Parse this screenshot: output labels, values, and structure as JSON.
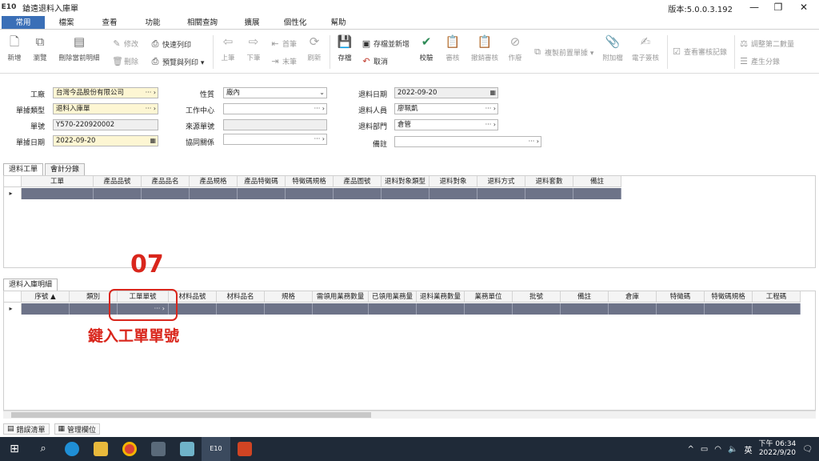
{
  "window": {
    "app_logo": "E10",
    "title": "鎗遠退料入庫單",
    "version": "版本:5.0.0.3.192",
    "min": "—",
    "restore": "❐",
    "close": "✕"
  },
  "menu": [
    "常用",
    "檔案",
    "查看",
    "功能",
    "相關查詢",
    "擴展",
    "個性化",
    "幫助"
  ],
  "toolbar": {
    "new": "新增",
    "browse": "瀏覽",
    "delete_current": "刪除當前明細",
    "modify": "修改",
    "delete": "刪除",
    "quick_print": "快速列印",
    "preview_print": "預覽與列印 ▾",
    "prev": "上筆",
    "next": "下筆",
    "first": "首筆",
    "last": "末筆",
    "refresh": "刷新",
    "save": "存檔",
    "save_new": "存檔並新增",
    "cancel": "取消",
    "check": "校驗",
    "review": "審核",
    "unreview": "撤銷審核",
    "void": "作廢",
    "copy_prev": "複製前置單據 ▾",
    "attach": "附加檔",
    "esign": "電子簽核",
    "view_review": "查看審核記錄",
    "adjust_qty2": "調整第二數量",
    "gen_split": "產生分錄"
  },
  "form": {
    "factory_label": "工廠",
    "factory_value": "台灣今品股份有限公司",
    "doctype_label": "單據類型",
    "doctype_value": "退料入庫單",
    "docno_label": "單號",
    "docno_value": "Y570-220920002",
    "docdate_label": "單據日期",
    "docdate_value": "2022-09-20",
    "nature_label": "性質",
    "nature_value": "廠內",
    "workcenter_label": "工作中心",
    "workcenter_value": "",
    "source_label": "來源單號",
    "source_value": "",
    "coop_label": "協同關係",
    "coop_value": "",
    "retdate_label": "退料日期",
    "retdate_value": "2022-09-20",
    "retperson_label": "退料人員",
    "retperson_value": "廖珮凱",
    "retdept_label": "退料部門",
    "retdept_value": "倉管",
    "remark_label": "備註",
    "remark_value": "",
    "dots": "···",
    "arrow": "›",
    "cal": "▦",
    "down": "⌄"
  },
  "tabs_top": [
    "退料工單",
    "會計分錄"
  ],
  "grid_top": {
    "headers": [
      "工單",
      "產品品號",
      "產品品名",
      "產品規格",
      "產品特徵碼",
      "特徵碼規格",
      "產品圖號",
      "退料對象類型",
      "退料對象",
      "退料方式",
      "退料套數",
      "備註"
    ]
  },
  "tabs_detail": [
    "退料入庫明細"
  ],
  "grid_detail": {
    "headers": [
      "序號",
      "類別",
      "工單單號",
      "材料品號",
      "材料品名",
      "規格",
      "需領用業務數量",
      "已領用業務量",
      "退料業務數量",
      "業務單位",
      "批號",
      "備註",
      "倉庫",
      "特徵碼",
      "特徵碼規格",
      "工程碼"
    ],
    "sort_mark": "▲",
    "cell_dots": "··· ›"
  },
  "row_marker": "▸",
  "annotation": {
    "number": "07",
    "text": "鍵入工單單號"
  },
  "bottom_tabs": [
    "錯誤清單",
    "管理欄位"
  ],
  "taskbar": {
    "time": "下午 06:34",
    "date": "2022/9/20",
    "ime": "英",
    "tray_up": "^"
  },
  "colors": {
    "accent": "#3a6fb7",
    "annotation": "#d9261c",
    "row_selected": "#6d7388"
  }
}
